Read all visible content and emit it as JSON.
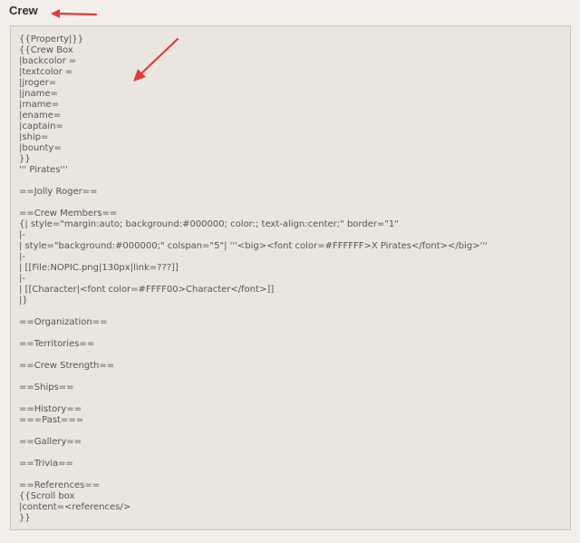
{
  "header": {
    "title": "Crew"
  },
  "accent_color": "#e53935",
  "editor": {
    "lines": [
      "{{Property|}}",
      "{{Crew Box",
      "|backcolor =",
      "|textcolor =",
      "|jroger=",
      "|jname=",
      "|rname=",
      "|ename=",
      "|captain=",
      "|ship=",
      "|bounty=",
      "}}",
      "''' Pirates'''",
      "",
      "==Jolly Roger==",
      "",
      "==Crew Members==",
      "{| style=\"margin:auto; background:#000000; color:; text-align:center;\" border=\"1\"",
      "|-",
      "| style=\"background:#000000;\" colspan=\"5\"| '''<big><font color=#FFFFFF>X Pirates</font></big>'''",
      "|-",
      "| [[File:NOPIC.png|130px|link=???]]",
      "|-",
      "| [[Character|<font color=#FFFF00>Character</font>]]",
      "|}",
      "",
      "==Organization==",
      "",
      "==Territories==",
      "",
      "==Crew Strength==",
      "",
      "==Ships==",
      "",
      "==History==",
      "===Past===",
      "",
      "==Gallery==",
      "",
      "==Trivia==",
      "",
      "==References==",
      "{{Scroll box",
      "|content=<references/>",
      "}}"
    ]
  }
}
